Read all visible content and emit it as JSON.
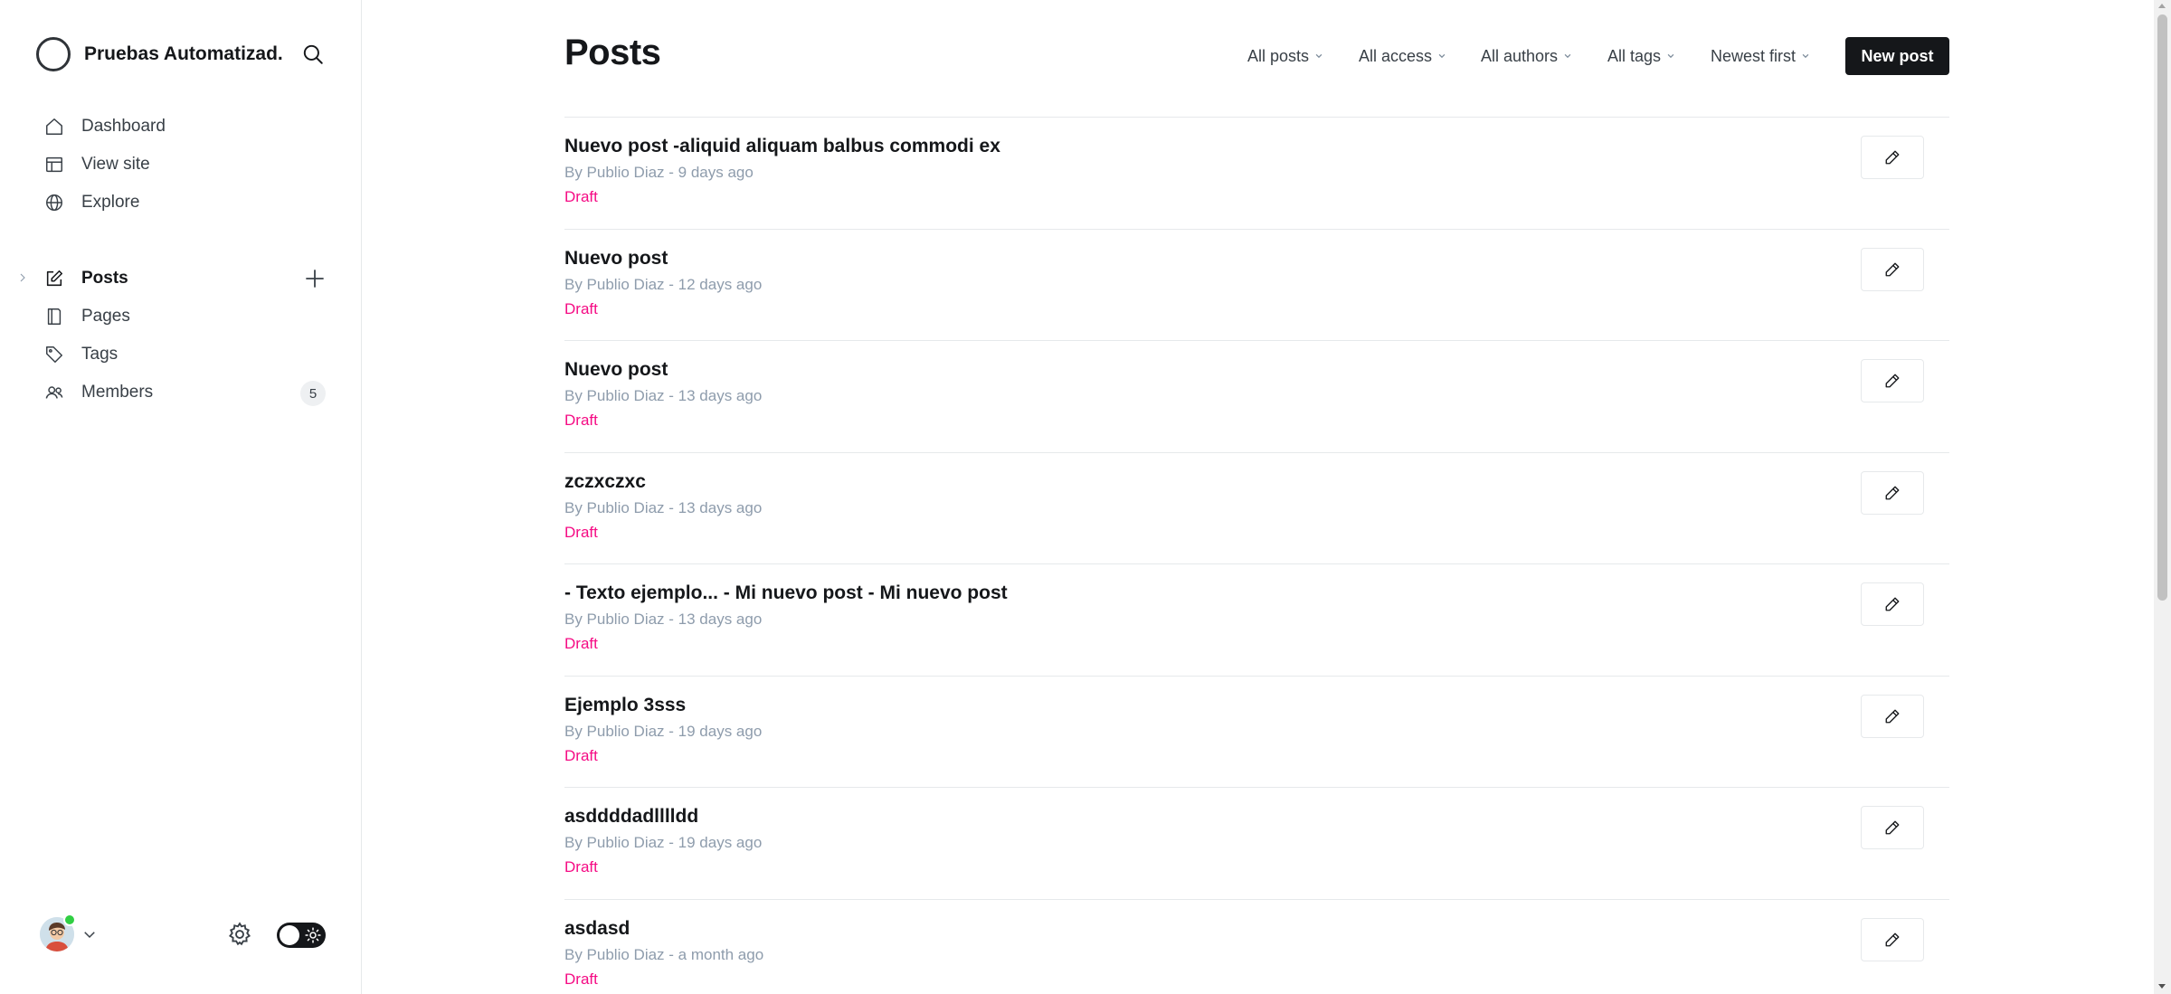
{
  "app": {
    "site_name": "Pruebas Automatizad...",
    "icons": {
      "logo": "ghost-logo-icon",
      "search": "search-icon"
    }
  },
  "sidebar": {
    "primary": [
      {
        "label": "Dashboard",
        "icon": "home-icon"
      },
      {
        "label": "View site",
        "icon": "layout-icon"
      },
      {
        "label": "Explore",
        "icon": "globe-icon"
      }
    ],
    "secondary": [
      {
        "label": "Posts",
        "icon": "pencil-square-icon",
        "active": true
      },
      {
        "label": "Pages",
        "icon": "page-icon"
      },
      {
        "label": "Tags",
        "icon": "tag-icon"
      },
      {
        "label": "Members",
        "icon": "members-icon",
        "count": "5"
      }
    ],
    "footer": {
      "icons": {
        "avatar": "user-avatar",
        "chevron": "chevron-down-icon",
        "settings": "gear-icon",
        "theme": "sun-icon"
      },
      "online_status_color": "#30cf43",
      "dark_mode": false
    }
  },
  "main": {
    "title": "Posts",
    "filters": [
      {
        "label": "All posts"
      },
      {
        "label": "All access"
      },
      {
        "label": "All authors"
      },
      {
        "label": "All tags"
      },
      {
        "label": "Newest first"
      }
    ],
    "new_post_label": "New post",
    "posts": [
      {
        "title": "Nuevo post -aliquid aliquam balbus commodi ex",
        "meta": "By Publio Diaz - 9 days ago",
        "status": "Draft"
      },
      {
        "title": "Nuevo post",
        "meta": "By Publio Diaz - 12 days ago",
        "status": "Draft"
      },
      {
        "title": "Nuevo post",
        "meta": "By Publio Diaz - 13 days ago",
        "status": "Draft"
      },
      {
        "title": "zczxczxc",
        "meta": "By Publio Diaz - 13 days ago",
        "status": "Draft"
      },
      {
        "title": "- Texto ejemplo... - Mi nuevo post - Mi nuevo post",
        "meta": "By Publio Diaz - 13 days ago",
        "status": "Draft"
      },
      {
        "title": "Ejemplo 3sss",
        "meta": "By Publio Diaz - 19 days ago",
        "status": "Draft"
      },
      {
        "title": "asddddadlllldd",
        "meta": "By Publio Diaz - 19 days ago",
        "status": "Draft"
      },
      {
        "title": "asdasd",
        "meta": "By Publio Diaz - a month ago",
        "status": "Draft"
      }
    ]
  },
  "colors": {
    "accent_dark": "#15171a",
    "draft_status": "#f50b84",
    "meta_text": "#8e9cac",
    "divider": "#e6e9eb"
  }
}
